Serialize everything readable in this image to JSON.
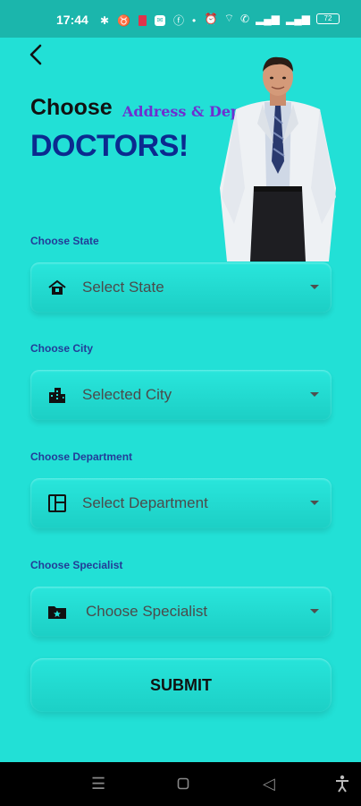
{
  "status_bar": {
    "time": "17:44",
    "battery": "72"
  },
  "header": {
    "title_main": "Choose",
    "title_sub": "Address & Departments",
    "title_big": "DOCTORS!"
  },
  "fields": [
    {
      "label": "Choose State",
      "value": "Select State",
      "icon": "state-icon"
    },
    {
      "label": "Choose City",
      "value": "Selected City",
      "icon": "city-icon"
    },
    {
      "label": "Choose Department",
      "value": "Select Department",
      "icon": "department-icon"
    },
    {
      "label": "Choose Specialist",
      "value": "Choose Specialist",
      "icon": "specialist-icon"
    }
  ],
  "submit_label": "SUBMIT",
  "colors": {
    "background": "#22e0d6",
    "statusbar": "#1bb6ac",
    "title_sub": "#6f2fd0",
    "title_big": "#0b2a8f",
    "label": "#233c98"
  }
}
